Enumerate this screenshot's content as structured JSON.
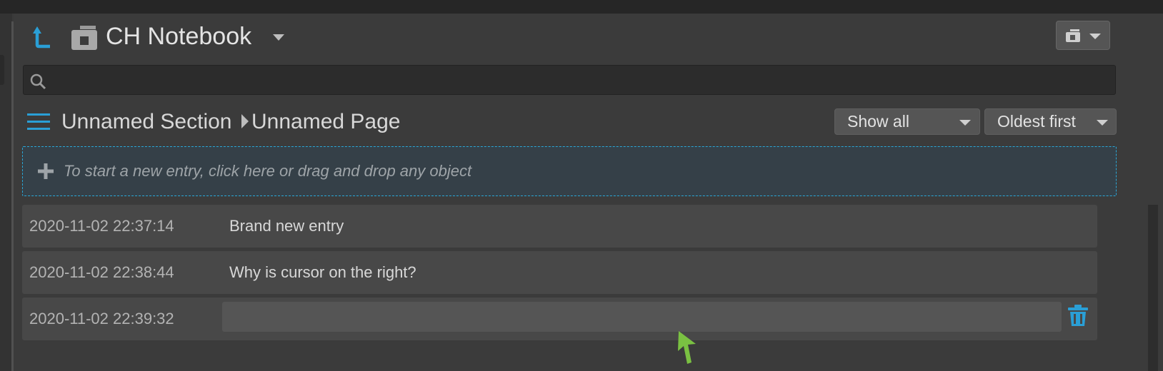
{
  "notebook": {
    "title": "CH Notebook"
  },
  "search": {
    "value": "",
    "placeholder": ""
  },
  "breadcrumb": {
    "section": "Unnamed Section",
    "page": "Unnamed Page"
  },
  "filters": {
    "show": "Show all",
    "order": "Oldest first"
  },
  "new_entry": {
    "hint": "To start a new entry, click here or drag and drop any object"
  },
  "entries": [
    {
      "timestamp": "2020-11-02 22:37:14",
      "text": "Brand new entry"
    },
    {
      "timestamp": "2020-11-02 22:38:44",
      "text": "Why is cursor on the right?"
    },
    {
      "timestamp": "2020-11-02 22:39:32",
      "text": ""
    }
  ],
  "icons": {
    "back": "back-arrow-icon",
    "notebook": "notebook-icon",
    "search": "search-icon",
    "menu": "hamburger-menu-icon",
    "add": "plus-icon",
    "delete": "trash-icon"
  },
  "colors": {
    "accent": "#2a9fd6",
    "cursor": "#7ac142",
    "background": "#3b3b3b"
  }
}
